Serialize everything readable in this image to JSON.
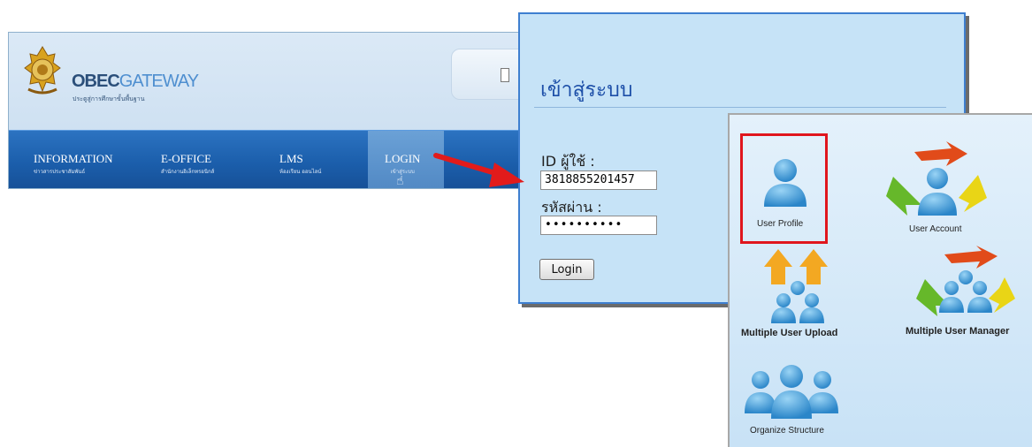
{
  "portal": {
    "brand_main": "OBEC",
    "brand_accent": "GATEWAY",
    "brand_sub": "ประตูสู่การศึกษาขั้นพื้นฐาน",
    "nav": [
      {
        "label": "INFORMATION",
        "sub": "ข่าวสารประชาสัมพันธ์"
      },
      {
        "label": "E-OFFICE",
        "sub": "สำนักงานอิเล็กทรอนิกส์"
      },
      {
        "label": "LMS",
        "sub": "ห้องเรียน ออนไลน์"
      },
      {
        "label": "LOGIN",
        "sub": "เข้าสู่ระบบ"
      }
    ]
  },
  "login": {
    "title": "เข้าสู่ระบบ",
    "id_label": "ID ผู้ใช้ :",
    "id_value": "3818855201457",
    "password_label": "รหัสผ่าน :",
    "password_value": "••••••••••",
    "button": "Login"
  },
  "tools": {
    "user_profile": "User Profile",
    "user_account": "User Account",
    "multiple_user_upload": "Multiple User Upload",
    "multiple_user_manager": "Multiple User Manager",
    "organize_structure": "Organize Structure"
  },
  "colors": {
    "nav_blue": "#1b5eab",
    "panel_blue": "#c6e3f7",
    "highlight_red": "#e0161d",
    "title_blue": "#1d4fa8"
  },
  "icons": [
    "obec-seal-icon",
    "hand-cursor-icon",
    "person-icon",
    "recycle-arrows-icon",
    "upload-arrows-icon",
    "people-group-icon"
  ]
}
